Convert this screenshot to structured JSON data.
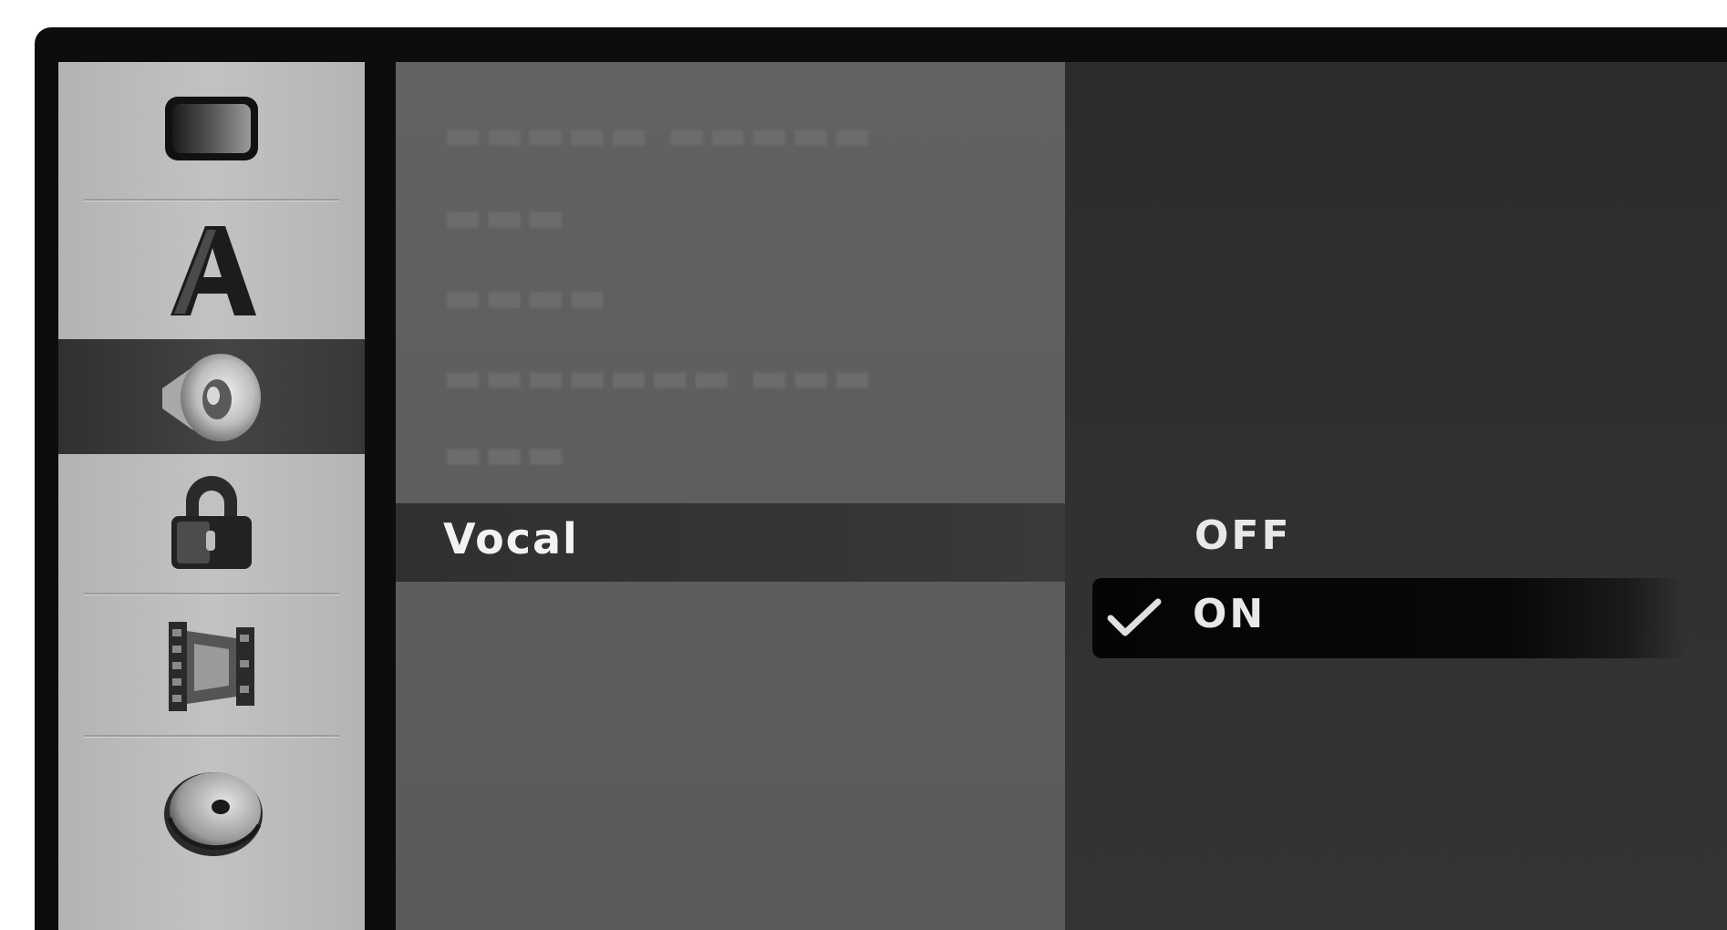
{
  "sidebar": {
    "items": [
      {
        "icon": "tv-screen-icon"
      },
      {
        "icon": "language-a-icon"
      },
      {
        "icon": "speaker-audio-icon",
        "selected": true
      },
      {
        "icon": "lock-icon"
      },
      {
        "icon": "film-recording-icon"
      },
      {
        "icon": "disc-icon"
      }
    ]
  },
  "menu": {
    "selected_label": "Vocal"
  },
  "options": {
    "off_label": "OFF",
    "on_label": "ON",
    "checked": "ON",
    "check_icon": "checkmark-icon"
  },
  "colors": {
    "selected_category_bg": "#3b3b3b",
    "menu_panel_bg": "#5e5e5e",
    "value_panel_bg": "#2f2f2f",
    "highlight_text": "#f2f2f2"
  }
}
